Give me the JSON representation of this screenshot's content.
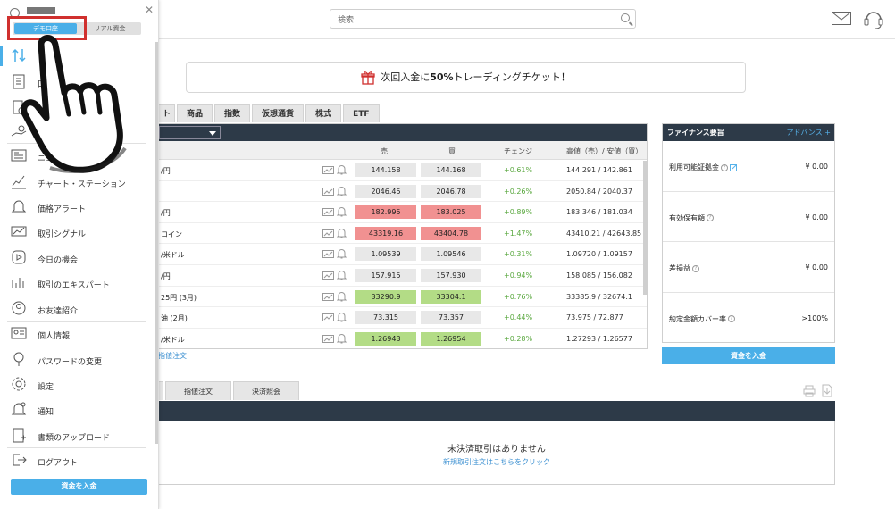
{
  "header": {
    "search_placeholder": "検索",
    "icons": [
      "search-icon",
      "mail-icon",
      "support-headset-icon"
    ]
  },
  "banner": {
    "text_pre": "次回入金に",
    "text_bold": "50%",
    "text_post": "トレーディングチケット！",
    "icon": "gift-icon"
  },
  "market_tabs": {
    "cut_label": "ト",
    "items": [
      "商品",
      "指数",
      "仮想通貨",
      "株式",
      "ETF"
    ]
  },
  "quotes": {
    "columns": {
      "sell": "売",
      "buy": "買",
      "change": "チェンジ",
      "high_low": "高値（売）/ 安値（買）"
    },
    "rows": [
      {
        "name": "/円",
        "sell": "144.158",
        "buy": "144.168",
        "change": "+0.61%",
        "high_low": "144.291 / 142.861",
        "color": "none"
      },
      {
        "name": "",
        "sell": "2046.45",
        "buy": "2046.78",
        "change": "+0.26%",
        "high_low": "2050.84 / 2040.37",
        "color": "none"
      },
      {
        "name": "/円",
        "sell": "182.995",
        "buy": "183.025",
        "change": "+0.89%",
        "high_low": "183.346 / 181.034",
        "color": "red"
      },
      {
        "name": "コイン",
        "sell": "43319.16",
        "buy": "43404.78",
        "change": "+1.47%",
        "high_low": "43410.21 / 42643.85",
        "color": "red"
      },
      {
        "name": "/米ドル",
        "sell": "1.09539",
        "buy": "1.09546",
        "change": "+0.31%",
        "high_low": "1.09720 / 1.09157",
        "color": "none"
      },
      {
        "name": "/円",
        "sell": "157.915",
        "buy": "157.930",
        "change": "+0.94%",
        "high_low": "158.085 / 156.082",
        "color": "none"
      },
      {
        "name": "25円 (3月)",
        "sell": "33290.9",
        "buy": "33304.1",
        "change": "+0.76%",
        "high_low": "33385.9 / 32674.1",
        "color": "green"
      },
      {
        "name": "油 (2月)",
        "sell": "73.315",
        "buy": "73.357",
        "change": "+0.44%",
        "high_low": "73.975 / 72.877",
        "color": "none"
      },
      {
        "name": "/米ドル",
        "sell": "1.26943",
        "buy": "1.26954",
        "change": "+0.28%",
        "high_low": "1.27293 / 1.26577",
        "color": "green"
      }
    ],
    "limit_order_link": "指値注文"
  },
  "finance": {
    "title": "ファイナンス要旨",
    "advanced": "アドバンス",
    "rows": [
      {
        "label": "利用可能証拠金",
        "value": "¥ 0.00"
      },
      {
        "label": "有効保有額",
        "value": "¥ 0.00"
      },
      {
        "label": "差損益",
        "value": "¥ 0.00"
      },
      {
        "label": "約定金額カバー率",
        "value": ">100%"
      }
    ],
    "deposit_button": "資金を入金"
  },
  "bottom": {
    "tabs": [
      "指値注文",
      "決済照会"
    ],
    "empty_message": "未決済取引はありません",
    "new_trade_link": "新規取引注文はこちらをクリック",
    "icons": [
      "print-icon",
      "export-icon"
    ]
  },
  "side_menu": {
    "modes": {
      "demo": "デモ口座",
      "real": "リアル資金",
      "selected": "demo"
    },
    "items": [
      {
        "label": "",
        "icon": "trade-arrows-icon"
      },
      {
        "label": "口",
        "icon": "document-icon"
      },
      {
        "label": "",
        "icon": "history-icon"
      },
      {
        "label": "",
        "icon": "hand-coin-icon"
      },
      {
        "label": "ニュー",
        "icon": "news-icon"
      },
      {
        "label": "チャート・ステーション",
        "icon": "chart-line-icon"
      },
      {
        "label": "価格アラート",
        "icon": "bell-icon"
      },
      {
        "label": "取引シグナル",
        "icon": "signal-icon"
      },
      {
        "label": "今日の機会",
        "icon": "play-icon"
      },
      {
        "label": "取引のエキスパート",
        "icon": "expert-chart-icon"
      },
      {
        "label": "お友達紹介",
        "icon": "friend-icon"
      },
      {
        "label": "個人情報",
        "icon": "id-card-icon"
      },
      {
        "label": "パスワードの変更",
        "icon": "key-icon"
      },
      {
        "label": "設定",
        "icon": "gear-icon"
      },
      {
        "label": "通知",
        "icon": "notification-bell-icon"
      },
      {
        "label": "書類のアップロード",
        "icon": "upload-document-icon"
      },
      {
        "label": "ログアウト",
        "icon": "logout-icon"
      }
    ],
    "deposit_button": "資金を入金"
  },
  "colors": {
    "accent": "#4aafe8",
    "dark_header": "#2d3a48",
    "highlight_border": "#d0302e",
    "sell_red": "#f19191",
    "buy_green": "#b3dc86",
    "change_green": "#5aa83f"
  }
}
